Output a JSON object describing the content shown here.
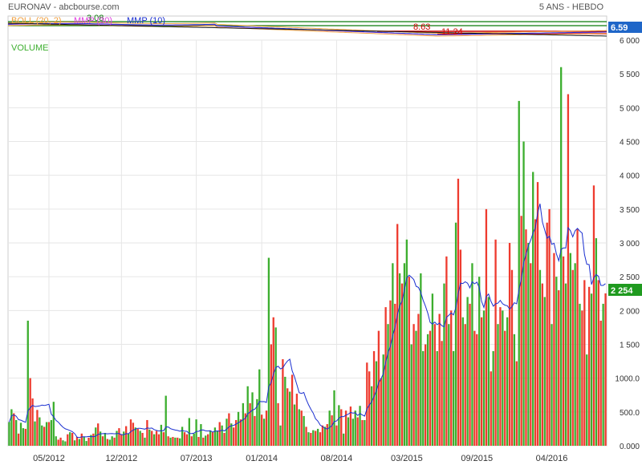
{
  "header": {
    "title": "EURONAV - abcbourse.com",
    "period": "5 ANS - HEBDO"
  },
  "colors": {
    "up": "#3cae2e",
    "down": "#ee3b2f",
    "average": "#1a2fd0",
    "boll": "#f0a040",
    "mmp_short": "#e040e0",
    "last_price_badge": "#1f66c8",
    "last_volume_badge": "#1f9a1f",
    "volume_label": "#3cae2e",
    "grid": "#e6e6e6"
  },
  "price_panel": {
    "legend": [
      {
        "label": "BOLL (20, 2)",
        "color": "#f0a040"
      },
      {
        "label": "MMP (30)",
        "color": "#e040e0"
      },
      {
        "label": "MMP (10)",
        "color": "#1a2fd0"
      }
    ],
    "annotations": [
      "3.08",
      "8.63",
      "11.24"
    ],
    "last_price": "6.59",
    "ylim": [
      2,
      13
    ]
  },
  "chart_data": {
    "type": "bar",
    "title": "VOLUME",
    "xlabel": "",
    "ylabel": "",
    "ylim": [
      0,
      6000
    ],
    "y_ticks": [
      "0.000",
      "500.0",
      "1000.0",
      "1 500",
      "2 000",
      "2 500",
      "3 000",
      "3 500",
      "4 000",
      "4 500",
      "5 000",
      "5 500",
      "6 000"
    ],
    "x_tick_labels": [
      "05/2012",
      "12/2012",
      "07/2013",
      "01/2014",
      "08/2014",
      "03/2015",
      "09/2015",
      "04/2016"
    ],
    "x_tick_index": [
      17,
      48,
      80,
      108,
      140,
      170,
      200,
      232
    ],
    "last_volume": "2 254",
    "series": [
      {
        "values": [
          350,
          540,
          480,
          380,
          180,
          340,
          260,
          250,
          1850,
          1000,
          700,
          360,
          530,
          420,
          300,
          280,
          350,
          350,
          380,
          650,
          140,
          90,
          120,
          80,
          65,
          170,
          200,
          190,
          80,
          130,
          100,
          180,
          130,
          70,
          120,
          160,
          180,
          270,
          330,
          210,
          140,
          190,
          100,
          90,
          140,
          120,
          220,
          260,
          170,
          210,
          290,
          180,
          390,
          340,
          270,
          250,
          220,
          190,
          120,
          380,
          240,
          220,
          170,
          220,
          170,
          310,
          200,
          740,
          140,
          120,
          130,
          120,
          120,
          110,
          280,
          200,
          170,
          410,
          140,
          180,
          390,
          130,
          320,
          120,
          150,
          170,
          220,
          200,
          270,
          220,
          350,
          300,
          190,
          400,
          480,
          330,
          270,
          380,
          500,
          390,
          630,
          480,
          880,
          630,
          790,
          440,
          690,
          1130,
          460,
          400,
          520,
          2780,
          1500,
          1900,
          1750,
          630,
          300,
          1280,
          1020,
          850,
          800,
          1050,
          610,
          770,
          540,
          520,
          440,
          280,
          200,
          190,
          230,
          220,
          250,
          200,
          300,
          280,
          320,
          520,
          450,
          820,
          300,
          600,
          540,
          180,
          520,
          420,
          580,
          400,
          520,
          420,
          590,
          380,
          380,
          1230,
          1100,
          880,
          1400,
          1250,
          1700,
          1000,
          1350,
          2050,
          1800,
          2150,
          2700,
          2100,
          3280,
          2550,
          2400,
          2700,
          3050,
          2500,
          1500,
          1800,
          1700,
          1950,
          2550,
          1400,
          1500,
          1650,
          1700,
          2250,
          1800,
          1400,
          1950,
          1550,
          2400,
          2800,
          1800,
          2000,
          1400,
          3300,
          3950,
          2900,
          1900,
          1800,
          2200,
          2100,
          2700,
          1700,
          1650,
          2500,
          1900,
          2000,
          3500,
          2200,
          1100,
          1400,
          3050,
          1800,
          2050,
          2000,
          1700,
          1900,
          3000,
          2600,
          1650,
          1250,
          5100,
          3400,
          4500,
          3200,
          3000,
          2700,
          4050,
          3350,
          3900,
          2600,
          2400,
          2200,
          3300,
          3500,
          1800,
          2850,
          2500,
          2300,
          5600,
          2800,
          2400,
          5200,
          2850,
          2600,
          2700,
          3200,
          2100,
          2000,
          2450,
          1350,
          2350,
          2250,
          3850,
          3070,
          2450,
          1850,
          2100,
          2254
        ],
        "colors": [
          "g",
          "g",
          "r",
          "g",
          "r",
          "g",
          "g",
          "r",
          "g",
          "r",
          "r",
          "g",
          "r",
          "g",
          "g",
          "r",
          "g",
          "r",
          "g",
          "g",
          "g",
          "r",
          "r",
          "g",
          "g",
          "r",
          "g",
          "r",
          "g",
          "r",
          "g",
          "r",
          "g",
          "g",
          "r",
          "g",
          "r",
          "g",
          "r",
          "g",
          "r",
          "g",
          "r",
          "g",
          "g",
          "r",
          "g",
          "r",
          "r",
          "g",
          "r",
          "g",
          "r",
          "r",
          "g",
          "r",
          "g",
          "r",
          "g",
          "r",
          "g",
          "r",
          "g",
          "r",
          "r",
          "g",
          "r",
          "g",
          "r",
          "g",
          "r",
          "g",
          "r",
          "g",
          "g",
          "r",
          "r",
          "g",
          "r",
          "g",
          "g",
          "r",
          "g",
          "r",
          "g",
          "r",
          "g",
          "r",
          "g",
          "g",
          "r",
          "g",
          "r",
          "g",
          "r",
          "g",
          "r",
          "r",
          "g",
          "r",
          "g",
          "r",
          "g",
          "r",
          "g",
          "r",
          "g",
          "g",
          "r",
          "g",
          "r",
          "g",
          "r",
          "r",
          "g",
          "r",
          "g",
          "r",
          "g",
          "r",
          "g",
          "r",
          "g",
          "r",
          "g",
          "r",
          "g",
          "r",
          "g",
          "r",
          "g",
          "r",
          "g",
          "r",
          "r",
          "g",
          "r",
          "g",
          "r",
          "g",
          "r",
          "g",
          "r",
          "g",
          "r",
          "g",
          "r",
          "g",
          "g",
          "r",
          "g",
          "r",
          "g",
          "r",
          "r",
          "g",
          "r",
          "g",
          "r",
          "r",
          "g",
          "r",
          "g",
          "r",
          "g",
          "r",
          "r",
          "g",
          "r",
          "g",
          "g",
          "r",
          "g",
          "r",
          "g",
          "r",
          "g",
          "g",
          "r",
          "g",
          "r",
          "g",
          "r",
          "g",
          "r",
          "r",
          "g",
          "r",
          "g",
          "r",
          "g",
          "g",
          "r",
          "r",
          "g",
          "r",
          "g",
          "r",
          "g",
          "r",
          "r",
          "g",
          "r",
          "g",
          "r",
          "g",
          "r",
          "g",
          "r",
          "g",
          "r",
          "g",
          "r",
          "g",
          "r",
          "r",
          "g",
          "r",
          "g",
          "r",
          "g",
          "r",
          "g",
          "r",
          "g",
          "r",
          "r",
          "g",
          "r",
          "g",
          "r",
          "r",
          "g",
          "r",
          "g",
          "r",
          "g",
          "r",
          "g",
          "r",
          "g",
          "r",
          "g",
          "r",
          "g",
          "r",
          "r",
          "g",
          "r",
          "g",
          "r",
          "g",
          "r",
          "r",
          "g",
          "r",
          "g",
          "r"
        ]
      }
    ]
  }
}
